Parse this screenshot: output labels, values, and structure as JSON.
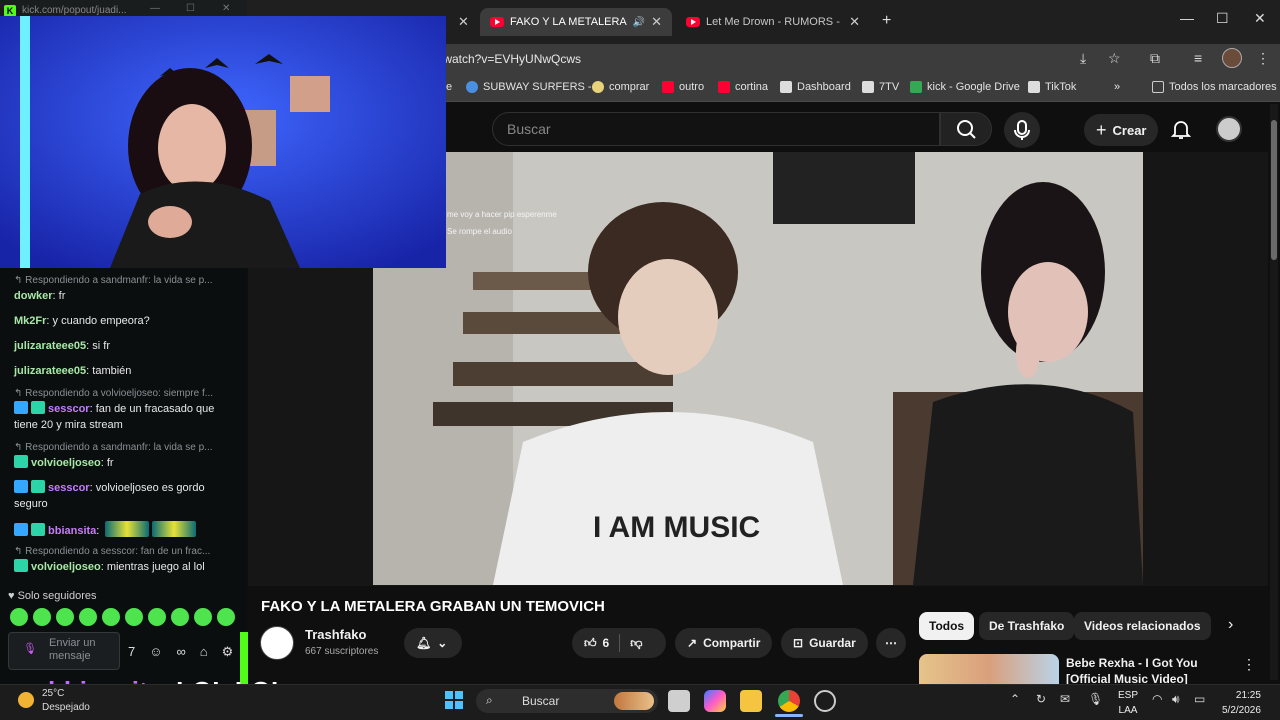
{
  "browser": {
    "tabs": [
      {
        "title": "FAKO Y LA METALERA GRAB",
        "active": true
      },
      {
        "title": "Let Me Drown - RUMORS - You",
        "active": false
      }
    ],
    "new_tab": "+",
    "url": "/watch?v=EVHyUNwQcws",
    "bookmarks": [
      {
        "label": "SUBWAY SURFERS -...",
        "color": "#4a90e2"
      },
      {
        "label": "comprar",
        "color": "#e8d27a"
      },
      {
        "label": "outro",
        "color": "#ff0033"
      },
      {
        "label": "cortina",
        "color": "#ff0033"
      },
      {
        "label": "Dashboard",
        "color": "#ffffff"
      },
      {
        "label": "7TV",
        "color": "#ffffff"
      },
      {
        "label": "kick - Google Drive",
        "color": "#34a853"
      },
      {
        "label": "TikTok",
        "color": "#ffffff"
      }
    ],
    "all_bookmarks": "Todos los marcadores",
    "kick_url": "kick.com/popout/juadi..."
  },
  "youtube": {
    "search_placeholder": "Buscar",
    "create_label": "Crear",
    "video_title": "FAKO Y LA METALERA GRABAN UN TEMOVICH",
    "channel_name": "Trashfako",
    "subscribers": "667 suscriptores",
    "likes": "6",
    "share_label": "Compartir",
    "save_label": "Guardar",
    "chips": [
      "Todos",
      "De Trashfako",
      "Videos relacionados"
    ],
    "rec_title": "Bebe Rexha - I Got You [Official Music Video]",
    "player_overlay_lines": [
      "me voy a hacer pip esperenme",
      "Se rompe el audio"
    ]
  },
  "chat": {
    "messages": [
      {
        "type": "reply",
        "text": "Respondiendo a sandmanfr: la vida se p..."
      },
      {
        "type": "msg",
        "user": "dowker",
        "color": "green",
        "text": "fr"
      },
      {
        "type": "msg",
        "user": "Mk2Fr",
        "color": "green",
        "text": "y cuando empeora?"
      },
      {
        "type": "msg",
        "user": "julizarateee05",
        "color": "green",
        "text": "si fr"
      },
      {
        "type": "msg",
        "user": "julizarateee05",
        "color": "green",
        "text": "también"
      },
      {
        "type": "reply",
        "text": "Respondiendo a volvioeljoseo: siempre f..."
      },
      {
        "type": "msg",
        "user": "sesscor",
        "color": "purple",
        "text": "fan de un fracasado que tiene 20 y mira stream"
      },
      {
        "type": "reply",
        "text": "Respondiendo a sandmanfr: la vida se p..."
      },
      {
        "type": "msg",
        "user": "volvioeljoseo",
        "color": "green",
        "text": "fr"
      },
      {
        "type": "msg",
        "user": "sesscor",
        "color": "purple",
        "text": "volvioeljoseo es gordo seguro"
      },
      {
        "type": "msg",
        "user": "bbiansita",
        "color": "purple",
        "text": ""
      },
      {
        "type": "reply",
        "text": "Respondiendo a sesscor: fan de un frac..."
      },
      {
        "type": "msg",
        "user": "volvioeljoseo",
        "color": "green",
        "text": "mientras juego al lol"
      }
    ],
    "followers_only": "Solo seguidores",
    "input_placeholder": "Enviar un mensaje"
  },
  "overlay": {
    "user": "bbiansita",
    "text": "LOL LOL"
  },
  "taskbar": {
    "weather_temp": "25°C",
    "weather_desc": "Despejado",
    "search": "Buscar",
    "lang_top": "ESP",
    "lang_bottom": "LAA",
    "time": "21:25",
    "date": "5/2/2026"
  }
}
